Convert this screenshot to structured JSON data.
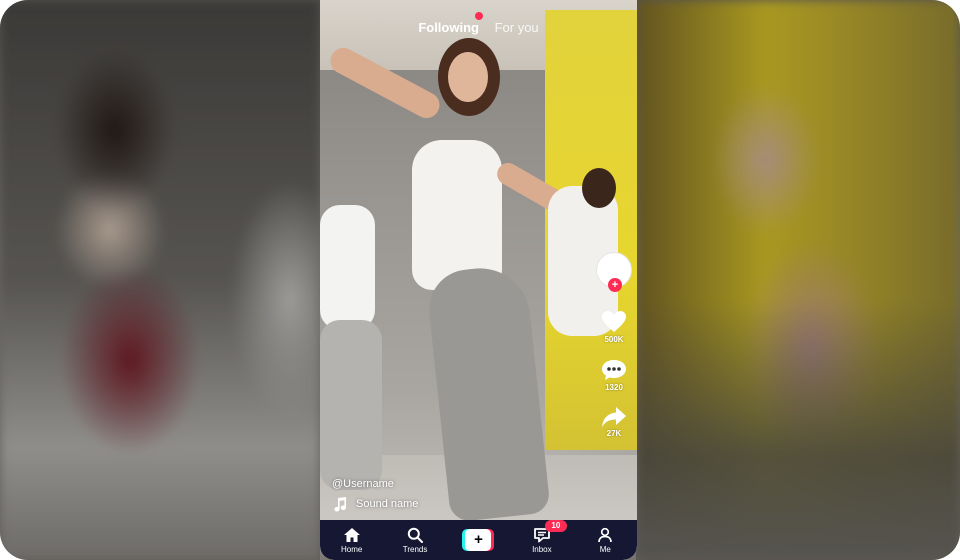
{
  "feed_tabs": [
    {
      "label": "Following",
      "active": true
    },
    {
      "label": "For you",
      "active": false
    }
  ],
  "actions": {
    "likes": "500K",
    "comments": "1320",
    "shares": "27K"
  },
  "post": {
    "username": "@Username",
    "sound": "Sound name"
  },
  "bottom_nav": [
    {
      "label": "Home",
      "icon": "home-icon"
    },
    {
      "label": "Trends",
      "icon": "search-icon"
    },
    {
      "label": "",
      "icon": "create-icon"
    },
    {
      "label": "Inbox",
      "icon": "inbox-icon",
      "badge": "10"
    },
    {
      "label": "Me",
      "icon": "profile-icon"
    }
  ],
  "colors": {
    "accent": "#fe2c55",
    "cyan": "#25f4ee",
    "nav_background": "#151733"
  }
}
